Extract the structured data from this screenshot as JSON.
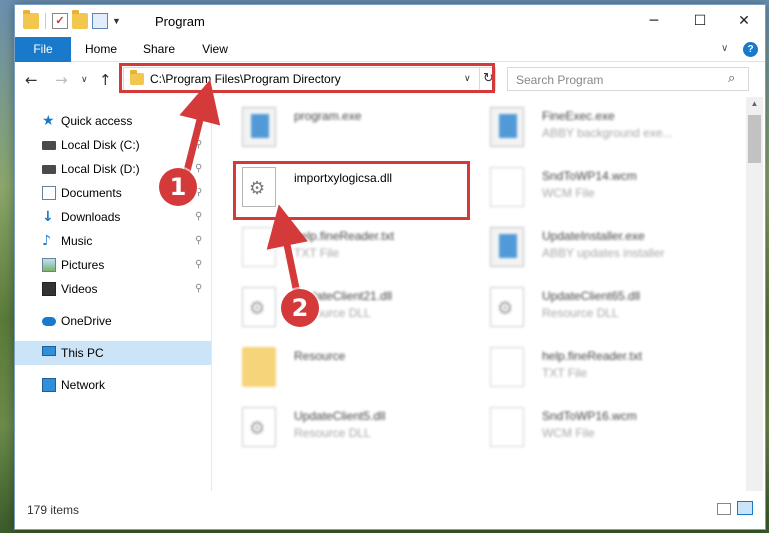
{
  "titlebar": {
    "title": "Program",
    "minimize": "─",
    "maximize": "☐",
    "close": "✕",
    "check_glyph": "✓"
  },
  "ribbon": {
    "tabs": [
      "File",
      "Home",
      "Share",
      "View"
    ],
    "help": "?"
  },
  "nav": {
    "back": "←",
    "forward": "→",
    "up": "↑",
    "recent": "∨",
    "refresh": "↻"
  },
  "address": {
    "path": "C:\\Program Files\\Program Directory"
  },
  "search": {
    "placeholder": "Search Program",
    "icon": "⌕"
  },
  "sidebar": {
    "items": [
      {
        "label": "Quick access",
        "icon": "star-icon",
        "glyph": "★"
      },
      {
        "label": "Local Disk (C:)",
        "icon": "disk-icon"
      },
      {
        "label": "Local Disk (D:)",
        "icon": "disk-icon"
      },
      {
        "label": "Documents",
        "icon": "documents-icon"
      },
      {
        "label": "Downloads",
        "icon": "download-icon",
        "glyph": "↓"
      },
      {
        "label": "Music",
        "icon": "music-icon",
        "glyph": "♪"
      },
      {
        "label": "Pictures",
        "icon": "pictures-icon"
      },
      {
        "label": "Videos",
        "icon": "videos-icon"
      },
      {
        "label": "OneDrive",
        "icon": "cloud-icon"
      },
      {
        "label": "This PC",
        "icon": "pc-icon",
        "selected": true
      },
      {
        "label": "Network",
        "icon": "network-icon"
      }
    ],
    "pin_glyph": "📌"
  },
  "files": [
    {
      "name": "program.exe",
      "desc": "",
      "type": "exe"
    },
    {
      "name": "FineExec.exe",
      "desc": "ABBY background exe...",
      "type": "exe"
    },
    {
      "name": "importxylogicsa.dll",
      "desc": "",
      "type": "dll",
      "highlighted": true
    },
    {
      "name": "SndToWP14.wcm",
      "desc": "WCM File",
      "type": "txt"
    },
    {
      "name": "help.fineReader.txt",
      "desc": "TXT File",
      "type": "txt"
    },
    {
      "name": "UpdateInstaller.exe",
      "desc": "ABBY updates installer",
      "type": "exe"
    },
    {
      "name": "UpdateClient21.dll",
      "desc": "Resource DLL",
      "type": "dll"
    },
    {
      "name": "UpdateClient65.dll",
      "desc": "Resource DLL",
      "type": "dll"
    },
    {
      "name": "Resource",
      "desc": "",
      "type": "folder"
    },
    {
      "name": "help.fineReader.txt",
      "desc": "TXT File",
      "type": "txt"
    },
    {
      "name": "UpdateClient5.dll",
      "desc": "Resource DLL",
      "type": "dll"
    },
    {
      "name": "SndToWP16.wcm",
      "desc": "WCM File",
      "type": "txt"
    }
  ],
  "status": {
    "count": "179 items"
  },
  "annotations": {
    "step1": "1",
    "step2": "2",
    "color": "#d53a3a"
  }
}
